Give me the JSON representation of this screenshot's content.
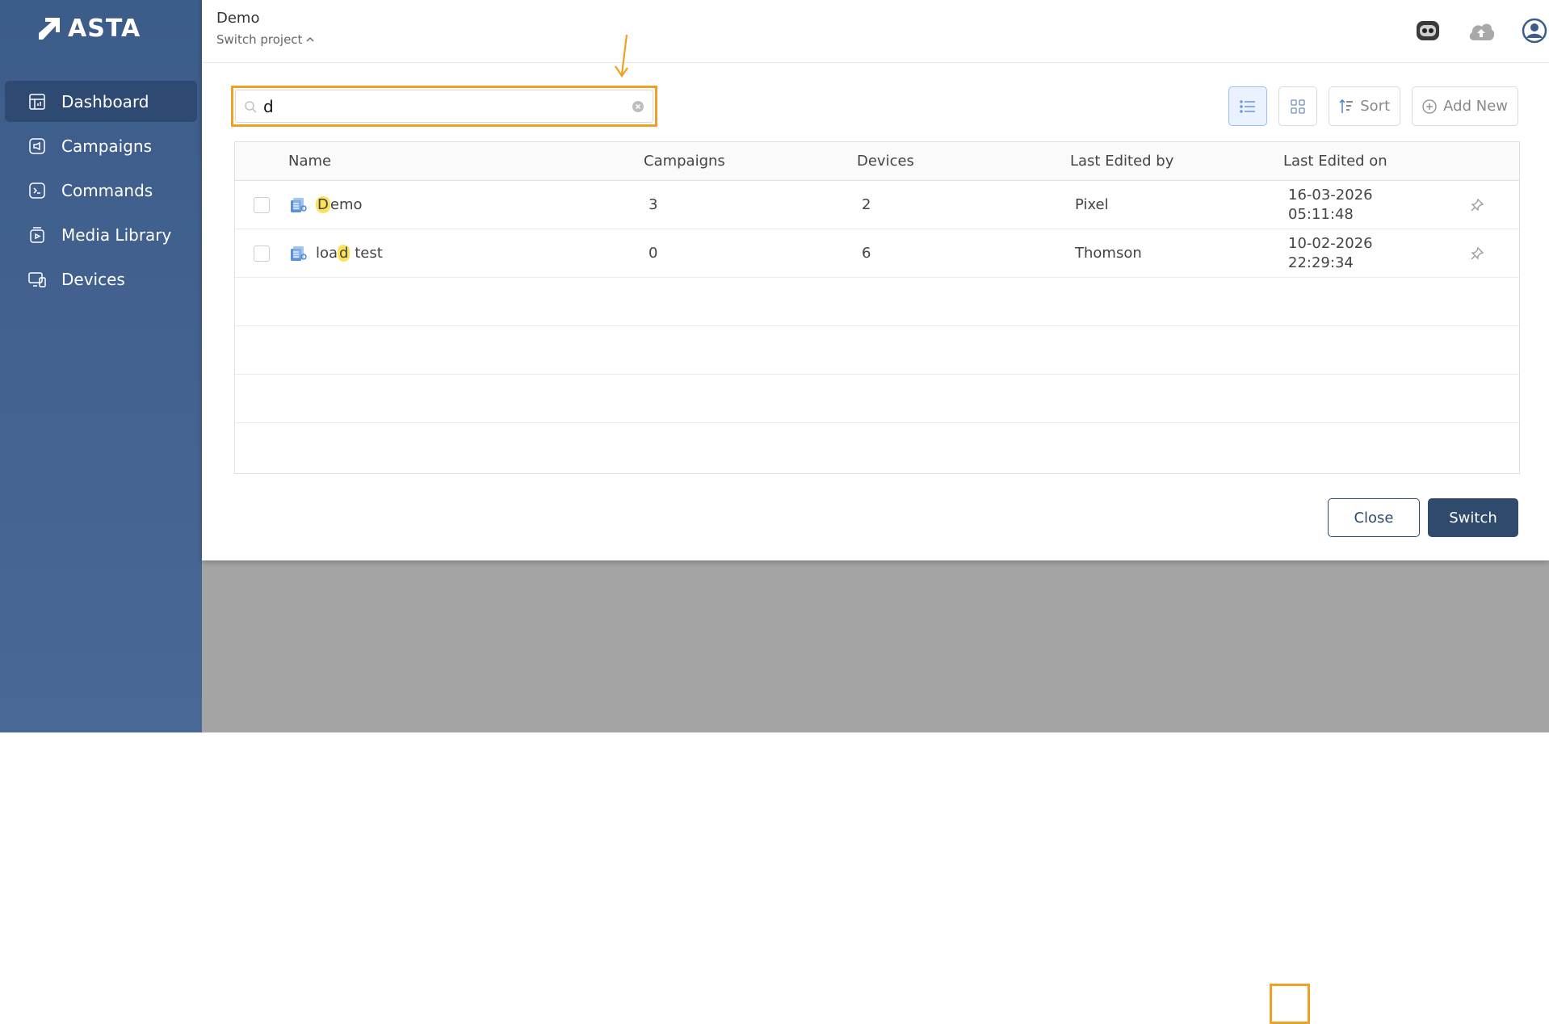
{
  "brand": {
    "name": "ASTA"
  },
  "sidebar": {
    "items": [
      {
        "label": "Dashboard",
        "icon": "dashboard-icon",
        "active": true
      },
      {
        "label": "Campaigns",
        "icon": "megaphone-icon",
        "active": false
      },
      {
        "label": "Commands",
        "icon": "terminal-icon",
        "active": false
      },
      {
        "label": "Media Library",
        "icon": "media-icon",
        "active": false
      },
      {
        "label": "Devices",
        "icon": "devices-icon",
        "active": false
      }
    ]
  },
  "header": {
    "project_name": "Demo",
    "switch_project_label": "Switch project"
  },
  "search": {
    "value": "d"
  },
  "toolbar": {
    "sort_label": "Sort",
    "add_new_label": "Add New"
  },
  "table": {
    "columns": [
      "Name",
      "Campaigns",
      "Devices",
      "Last Edited by",
      "Last Edited on"
    ],
    "rows": [
      {
        "name_pre": "",
        "name_match": "D",
        "name_post": "emo",
        "campaigns": "3",
        "devices": "2",
        "edited_by": "Pixel",
        "edited_date": "16-03-2026",
        "edited_time": "05:11:48"
      },
      {
        "name_pre": "loa",
        "name_match": "d",
        "name_post": " test",
        "campaigns": "0",
        "devices": "6",
        "edited_by": "Thomson",
        "edited_date": "10-02-2026",
        "edited_time": "22:29:34"
      }
    ]
  },
  "footer": {
    "close_label": "Close",
    "switch_label": "Switch"
  },
  "colors": {
    "sidebar": "#3c5c89",
    "accent": "#2f4a6d",
    "highlight": "#fbe25a",
    "annotation": "#f0a024"
  }
}
